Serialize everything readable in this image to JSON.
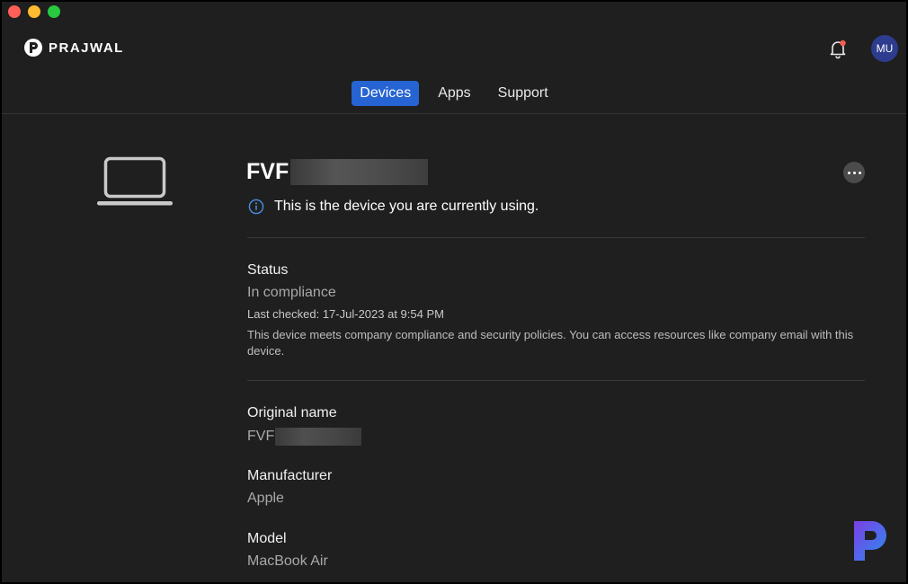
{
  "brand": {
    "name": "PRAJWAL"
  },
  "header": {
    "avatar_initials": "MU"
  },
  "tabs": [
    {
      "label": "Devices",
      "active": true
    },
    {
      "label": "Apps",
      "active": false
    },
    {
      "label": "Support",
      "active": false
    }
  ],
  "device": {
    "name_prefix": "FVF",
    "current_notice": "This is the device you are currently using."
  },
  "status": {
    "label": "Status",
    "value": "In compliance",
    "last_checked": "Last checked: 17-Jul-2023 at 9:54 PM",
    "description": "This device meets company compliance and security policies. You can access resources like company email with this device."
  },
  "details": {
    "original_name": {
      "label": "Original name",
      "value_prefix": "FVF"
    },
    "manufacturer": {
      "label": "Manufacturer",
      "value": "Apple"
    },
    "model": {
      "label": "Model",
      "value": "MacBook Air"
    }
  },
  "colors": {
    "accent": "#2764d3",
    "avatar": "#2d3c8e",
    "info_icon": "#4a90e2",
    "notification_dot": "#ff5a4f"
  }
}
